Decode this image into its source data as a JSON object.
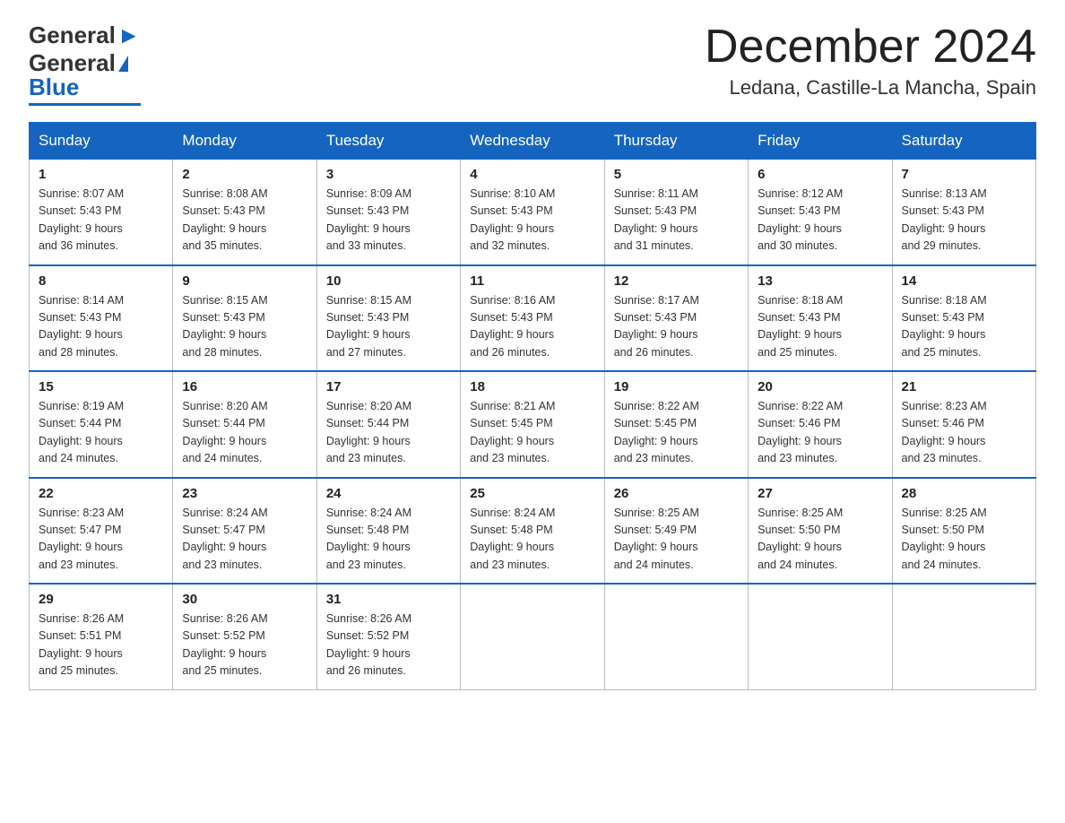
{
  "header": {
    "logo_general": "General",
    "logo_blue": "Blue",
    "month_title": "December 2024",
    "location": "Ledana, Castille-La Mancha, Spain"
  },
  "columns": [
    "Sunday",
    "Monday",
    "Tuesday",
    "Wednesday",
    "Thursday",
    "Friday",
    "Saturday"
  ],
  "weeks": [
    [
      {
        "day": "1",
        "sunrise": "8:07 AM",
        "sunset": "5:43 PM",
        "daylight": "9 hours and 36 minutes."
      },
      {
        "day": "2",
        "sunrise": "8:08 AM",
        "sunset": "5:43 PM",
        "daylight": "9 hours and 35 minutes."
      },
      {
        "day": "3",
        "sunrise": "8:09 AM",
        "sunset": "5:43 PM",
        "daylight": "9 hours and 33 minutes."
      },
      {
        "day": "4",
        "sunrise": "8:10 AM",
        "sunset": "5:43 PM",
        "daylight": "9 hours and 32 minutes."
      },
      {
        "day": "5",
        "sunrise": "8:11 AM",
        "sunset": "5:43 PM",
        "daylight": "9 hours and 31 minutes."
      },
      {
        "day": "6",
        "sunrise": "8:12 AM",
        "sunset": "5:43 PM",
        "daylight": "9 hours and 30 minutes."
      },
      {
        "day": "7",
        "sunrise": "8:13 AM",
        "sunset": "5:43 PM",
        "daylight": "9 hours and 29 minutes."
      }
    ],
    [
      {
        "day": "8",
        "sunrise": "8:14 AM",
        "sunset": "5:43 PM",
        "daylight": "9 hours and 28 minutes."
      },
      {
        "day": "9",
        "sunrise": "8:15 AM",
        "sunset": "5:43 PM",
        "daylight": "9 hours and 28 minutes."
      },
      {
        "day": "10",
        "sunrise": "8:15 AM",
        "sunset": "5:43 PM",
        "daylight": "9 hours and 27 minutes."
      },
      {
        "day": "11",
        "sunrise": "8:16 AM",
        "sunset": "5:43 PM",
        "daylight": "9 hours and 26 minutes."
      },
      {
        "day": "12",
        "sunrise": "8:17 AM",
        "sunset": "5:43 PM",
        "daylight": "9 hours and 26 minutes."
      },
      {
        "day": "13",
        "sunrise": "8:18 AM",
        "sunset": "5:43 PM",
        "daylight": "9 hours and 25 minutes."
      },
      {
        "day": "14",
        "sunrise": "8:18 AM",
        "sunset": "5:43 PM",
        "daylight": "9 hours and 25 minutes."
      }
    ],
    [
      {
        "day": "15",
        "sunrise": "8:19 AM",
        "sunset": "5:44 PM",
        "daylight": "9 hours and 24 minutes."
      },
      {
        "day": "16",
        "sunrise": "8:20 AM",
        "sunset": "5:44 PM",
        "daylight": "9 hours and 24 minutes."
      },
      {
        "day": "17",
        "sunrise": "8:20 AM",
        "sunset": "5:44 PM",
        "daylight": "9 hours and 23 minutes."
      },
      {
        "day": "18",
        "sunrise": "8:21 AM",
        "sunset": "5:45 PM",
        "daylight": "9 hours and 23 minutes."
      },
      {
        "day": "19",
        "sunrise": "8:22 AM",
        "sunset": "5:45 PM",
        "daylight": "9 hours and 23 minutes."
      },
      {
        "day": "20",
        "sunrise": "8:22 AM",
        "sunset": "5:46 PM",
        "daylight": "9 hours and 23 minutes."
      },
      {
        "day": "21",
        "sunrise": "8:23 AM",
        "sunset": "5:46 PM",
        "daylight": "9 hours and 23 minutes."
      }
    ],
    [
      {
        "day": "22",
        "sunrise": "8:23 AM",
        "sunset": "5:47 PM",
        "daylight": "9 hours and 23 minutes."
      },
      {
        "day": "23",
        "sunrise": "8:24 AM",
        "sunset": "5:47 PM",
        "daylight": "9 hours and 23 minutes."
      },
      {
        "day": "24",
        "sunrise": "8:24 AM",
        "sunset": "5:48 PM",
        "daylight": "9 hours and 23 minutes."
      },
      {
        "day": "25",
        "sunrise": "8:24 AM",
        "sunset": "5:48 PM",
        "daylight": "9 hours and 23 minutes."
      },
      {
        "day": "26",
        "sunrise": "8:25 AM",
        "sunset": "5:49 PM",
        "daylight": "9 hours and 24 minutes."
      },
      {
        "day": "27",
        "sunrise": "8:25 AM",
        "sunset": "5:50 PM",
        "daylight": "9 hours and 24 minutes."
      },
      {
        "day": "28",
        "sunrise": "8:25 AM",
        "sunset": "5:50 PM",
        "daylight": "9 hours and 24 minutes."
      }
    ],
    [
      {
        "day": "29",
        "sunrise": "8:26 AM",
        "sunset": "5:51 PM",
        "daylight": "9 hours and 25 minutes."
      },
      {
        "day": "30",
        "sunrise": "8:26 AM",
        "sunset": "5:52 PM",
        "daylight": "9 hours and 25 minutes."
      },
      {
        "day": "31",
        "sunrise": "8:26 AM",
        "sunset": "5:52 PM",
        "daylight": "9 hours and 26 minutes."
      },
      null,
      null,
      null,
      null
    ]
  ],
  "labels": {
    "sunrise": "Sunrise:",
    "sunset": "Sunset:",
    "daylight": "Daylight:"
  }
}
